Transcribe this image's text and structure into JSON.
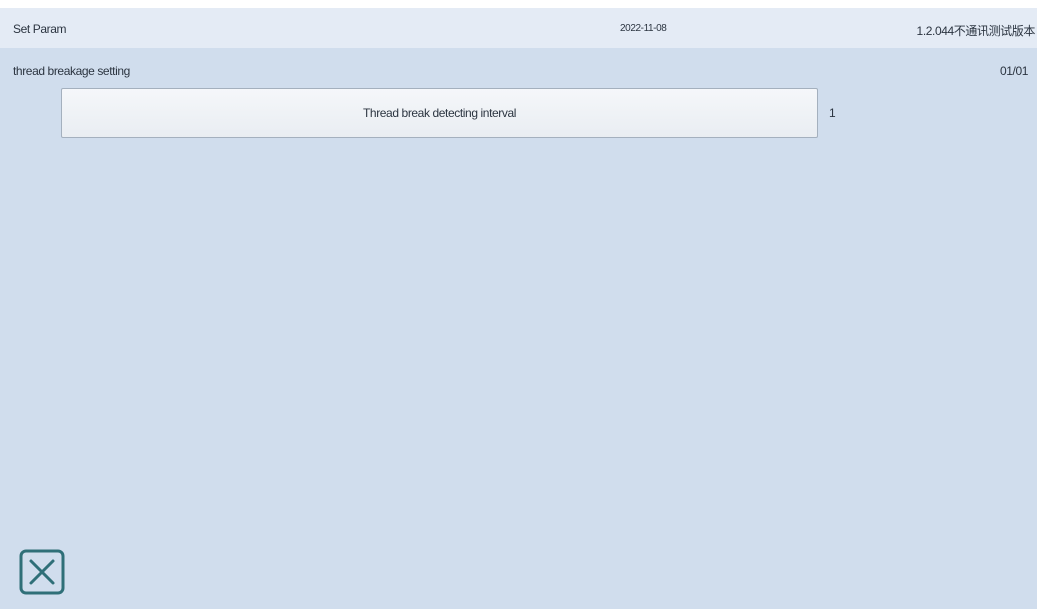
{
  "header": {
    "title": "Set Param",
    "date": "2022-11-08",
    "version": "1.2.044不通讯测试版本"
  },
  "section": {
    "title": "thread breakage setting",
    "page_indicator": "01/01"
  },
  "params": [
    {
      "label": "Thread break detecting interval",
      "value": "1"
    }
  ],
  "icons": {
    "close": "close-icon"
  },
  "colors": {
    "background": "#d0dded",
    "topbar": "#e4ebf5",
    "icon": "#2f6f78"
  }
}
